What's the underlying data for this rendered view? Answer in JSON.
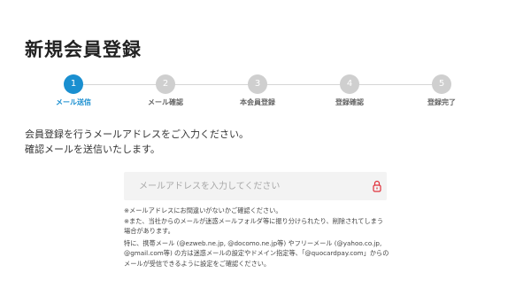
{
  "page": {
    "title": "新規会員登録"
  },
  "stepper": {
    "steps": [
      {
        "number": "1",
        "label": "メール送信",
        "active": true
      },
      {
        "number": "2",
        "label": "メール確認",
        "active": false
      },
      {
        "number": "3",
        "label": "本会員登録",
        "active": false
      },
      {
        "number": "4",
        "label": "登録確認",
        "active": false
      },
      {
        "number": "5",
        "label": "登録完了",
        "active": false
      }
    ]
  },
  "intro": {
    "line1": "会員登録を行うメールアドレスをご入力ください。",
    "line2": "確認メールを送信いたします。"
  },
  "email": {
    "placeholder": "メールアドレスを入力してください",
    "value": "",
    "icon": "lock-icon"
  },
  "notes": {
    "line1": "※メールアドレスにお間違いがないかご確認ください。",
    "line2": "※また、当社からのメールが迷惑メールフォルダ等に振り分けられたり、削除されてしまう場合があります。",
    "line3": "特に、携帯メール (@ezweb.ne.jp, @docomo.ne.jp等) やフリーメール (@yahoo.co.jp, @gmail.com等) の方は迷惑メールの設定やドメイン指定等、「@quocardpay.com」からのメールが受信できるように設定をご確認ください。"
  },
  "colors": {
    "accent": "#1a8fd0",
    "inactive_step": "#cfcfcf",
    "lock_icon": "#e0303a"
  }
}
